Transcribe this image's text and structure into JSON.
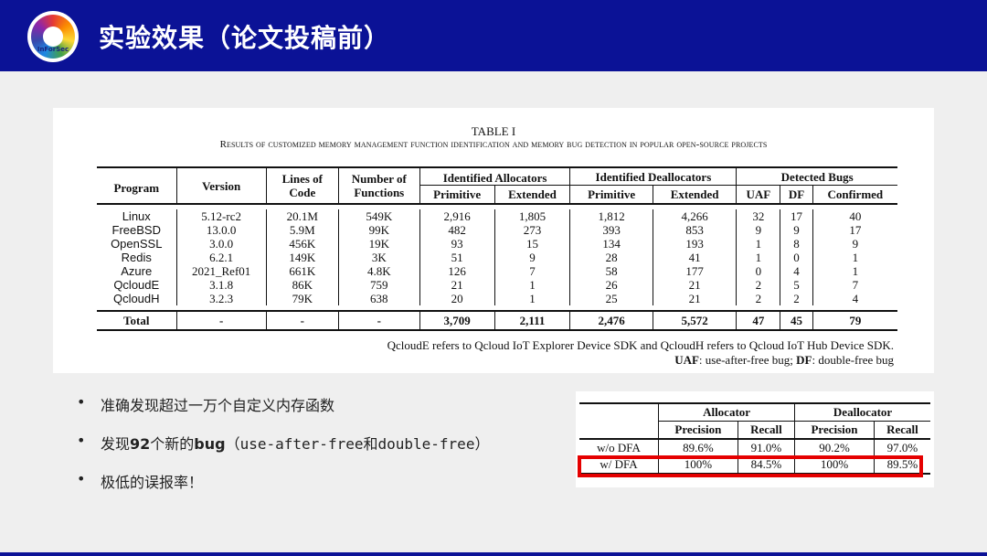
{
  "header": {
    "title": "实验效果（论文投稿前）",
    "logo_text": "InForSec"
  },
  "table": {
    "caption": "TABLE I",
    "subtitle": "Results of customized memory management function identification and memory bug detection in popular open-source projects",
    "headers": {
      "program": "Program",
      "version": "Version",
      "loc": "Lines of Code",
      "funcs": "Number of Functions",
      "alloc": "Identified Allocators",
      "dealloc": "Identified Deallocators",
      "bugs": "Detected Bugs",
      "primitive": "Primitive",
      "extended": "Extended",
      "uaf": "UAF",
      "df": "DF",
      "confirmed": "Confirmed"
    },
    "rows": [
      [
        "Linux",
        "5.12-rc2",
        "20.1M",
        "549K",
        "2,916",
        "1,805",
        "1,812",
        "4,266",
        "32",
        "17",
        "40"
      ],
      [
        "FreeBSD",
        "13.0.0",
        "5.9M",
        "99K",
        "482",
        "273",
        "393",
        "853",
        "9",
        "9",
        "17"
      ],
      [
        "OpenSSL",
        "3.0.0",
        "456K",
        "19K",
        "93",
        "15",
        "134",
        "193",
        "1",
        "8",
        "9"
      ],
      [
        "Redis",
        "6.2.1",
        "149K",
        "3K",
        "51",
        "9",
        "28",
        "41",
        "1",
        "0",
        "1"
      ],
      [
        "Azure",
        "2021_Ref01",
        "661K",
        "4.8K",
        "126",
        "7",
        "58",
        "177",
        "0",
        "4",
        "1"
      ],
      [
        "QcloudE",
        "3.1.8",
        "86K",
        "759",
        "21",
        "1",
        "26",
        "21",
        "2",
        "5",
        "7"
      ],
      [
        "QcloudH",
        "3.2.3",
        "79K",
        "638",
        "20",
        "1",
        "25",
        "21",
        "2",
        "2",
        "4"
      ]
    ],
    "total": [
      "Total",
      "-",
      "-",
      "-",
      "3,709",
      "2,111",
      "2,476",
      "5,572",
      "47",
      "45",
      "79"
    ],
    "note1": "QcloudE refers to Qcloud IoT Explorer Device SDK and QcloudH refers to Qcloud IoT Hub Device SDK.",
    "note2_uaf": "UAF",
    "note2_uaf_desc": ": use-after-free bug; ",
    "note2_df": "DF",
    "note2_df_desc": ": double-free bug"
  },
  "bullets": {
    "b1": "准确发现超过一万个自定义内存函数",
    "b2_a": "发现",
    "b2_b": "92",
    "b2_c": "个新的",
    "b2_d": "bug",
    "b2_e": "（",
    "b2_f": "use-after-free",
    "b2_g": "和",
    "b2_h": "double-free",
    "b2_i": "）",
    "b3": "极低的误报率！"
  },
  "small_table": {
    "allocator": "Allocator",
    "deallocator": "Deallocator",
    "precision": "Precision",
    "recall": "Recall",
    "rows": [
      [
        "w/o DFA",
        "89.6%",
        "91.0%",
        "90.2%",
        "97.0%"
      ],
      [
        "w/ DFA",
        "100%",
        "84.5%",
        "100%",
        "89.5%"
      ]
    ]
  },
  "colors": {
    "header_bg": "#0b1296",
    "highlight": "#e50000"
  }
}
